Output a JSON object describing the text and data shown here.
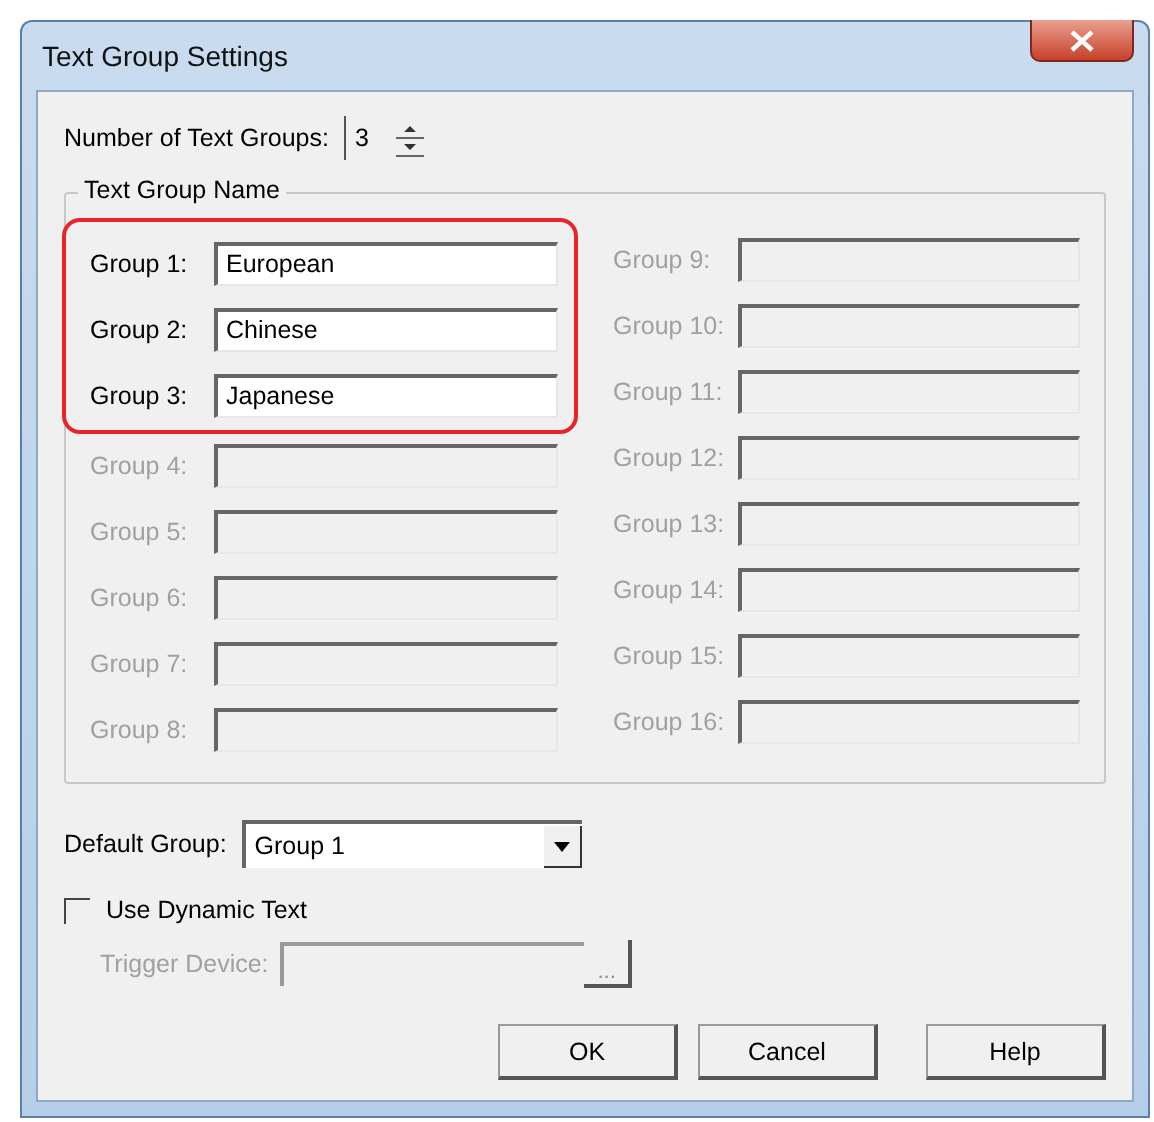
{
  "window": {
    "title": "Text Group Settings"
  },
  "number_of_groups": {
    "label": "Number of Text Groups:",
    "value": "3"
  },
  "text_group_name": {
    "legend": "Text Group Name",
    "groups": [
      {
        "label": "Group 1:",
        "value": "European",
        "disabled": false,
        "highlighted": true
      },
      {
        "label": "Group 2:",
        "value": "Chinese",
        "disabled": false,
        "highlighted": true
      },
      {
        "label": "Group 3:",
        "value": "Japanese",
        "disabled": false,
        "highlighted": true
      },
      {
        "label": "Group 4:",
        "disabled": true,
        "highlighted": false
      },
      {
        "label": "Group 5:",
        "disabled": true,
        "highlighted": false
      },
      {
        "label": "Group 6:",
        "disabled": true,
        "highlighted": false
      },
      {
        "label": "Group 7:",
        "disabled": true,
        "highlighted": false
      },
      {
        "label": "Group 8:",
        "disabled": true,
        "highlighted": false
      },
      {
        "label": "Group 9:",
        "disabled": true,
        "highlighted": false
      },
      {
        "label": "Group 10:",
        "disabled": true,
        "highlighted": false
      },
      {
        "label": "Group 11:",
        "disabled": true,
        "highlighted": false
      },
      {
        "label": "Group 12:",
        "disabled": true,
        "highlighted": false
      },
      {
        "label": "Group 13:",
        "disabled": true,
        "highlighted": false
      },
      {
        "label": "Group 14:",
        "disabled": true,
        "highlighted": false
      },
      {
        "label": "Group 15:",
        "disabled": true,
        "highlighted": false
      },
      {
        "label": "Group 16:",
        "disabled": true,
        "highlighted": false
      }
    ]
  },
  "default_group": {
    "label": "Default Group:",
    "value": "Group 1"
  },
  "use_dynamic_text": {
    "label": "Use Dynamic Text",
    "checked": false
  },
  "trigger_device": {
    "label": "Trigger Device:",
    "disabled": true,
    "browse": "..."
  },
  "buttons": [
    "OK",
    "Cancel",
    "Help"
  ]
}
